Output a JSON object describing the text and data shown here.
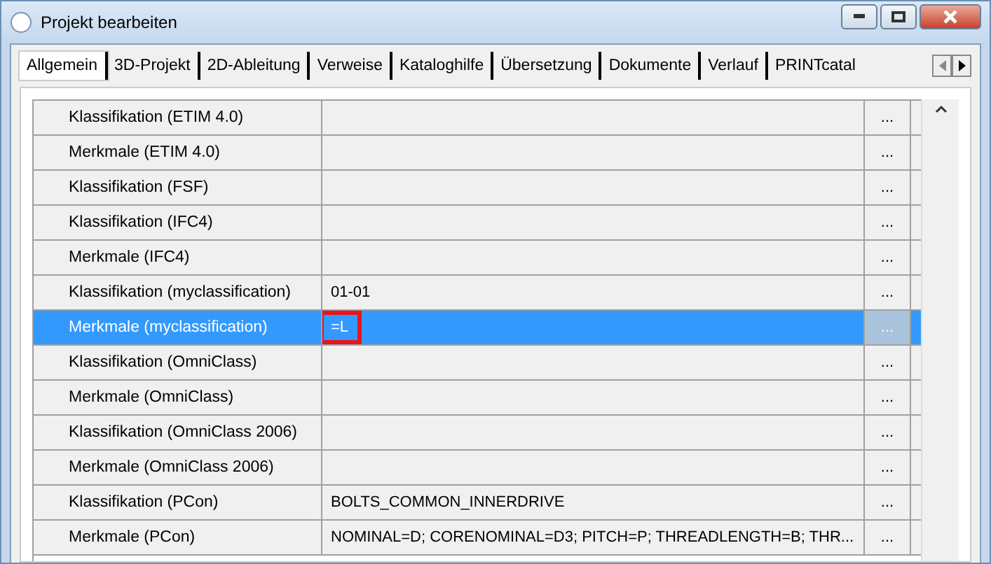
{
  "window": {
    "title": "Projekt bearbeiten"
  },
  "tabs": [
    {
      "label": "Allgemein",
      "selected": true
    },
    {
      "label": "3D-Projekt",
      "selected": false
    },
    {
      "label": "2D-Ableitung",
      "selected": false
    },
    {
      "label": "Verweise",
      "selected": false
    },
    {
      "label": "Kataloghilfe",
      "selected": false
    },
    {
      "label": "Übersetzung",
      "selected": false
    },
    {
      "label": "Dokumente",
      "selected": false
    },
    {
      "label": "Verlauf",
      "selected": false
    },
    {
      "label": "PRINTcatal",
      "selected": false
    }
  ],
  "table": {
    "rows": [
      {
        "name": "Klassifikation (ETIM 4.0)",
        "value": "",
        "button": "...",
        "selected": false,
        "highlighted": false
      },
      {
        "name": "Merkmale (ETIM 4.0)",
        "value": "",
        "button": "...",
        "selected": false,
        "highlighted": false
      },
      {
        "name": "Klassifikation (FSF)",
        "value": "",
        "button": "...",
        "selected": false,
        "highlighted": false
      },
      {
        "name": "Klassifikation (IFC4)",
        "value": "",
        "button": "...",
        "selected": false,
        "highlighted": false
      },
      {
        "name": "Merkmale (IFC4)",
        "value": "",
        "button": "...",
        "selected": false,
        "highlighted": false
      },
      {
        "name": "Klassifikation (myclassification)",
        "value": "01-01",
        "button": "...",
        "selected": false,
        "highlighted": false
      },
      {
        "name": "Merkmale (myclassification)",
        "value": "=L",
        "button": "...",
        "selected": true,
        "highlighted": true
      },
      {
        "name": "Klassifikation (OmniClass)",
        "value": "",
        "button": "...",
        "selected": false,
        "highlighted": false
      },
      {
        "name": "Merkmale (OmniClass)",
        "value": "",
        "button": "...",
        "selected": false,
        "highlighted": false
      },
      {
        "name": "Klassifikation (OmniClass 2006)",
        "value": "",
        "button": "...",
        "selected": false,
        "highlighted": false
      },
      {
        "name": "Merkmale (OmniClass 2006)",
        "value": "",
        "button": "...",
        "selected": false,
        "highlighted": false
      },
      {
        "name": "Klassifikation (PCon)",
        "value": "BOLTS_COMMON_INNERDRIVE",
        "button": "...",
        "selected": false,
        "highlighted": false
      },
      {
        "name": "Merkmale (PCon)",
        "value": "NOMINAL=D; CORENOMINAL=D3; PITCH=P; THREADLENGTH=B; THR...",
        "button": "...",
        "selected": false,
        "highlighted": false
      }
    ]
  }
}
